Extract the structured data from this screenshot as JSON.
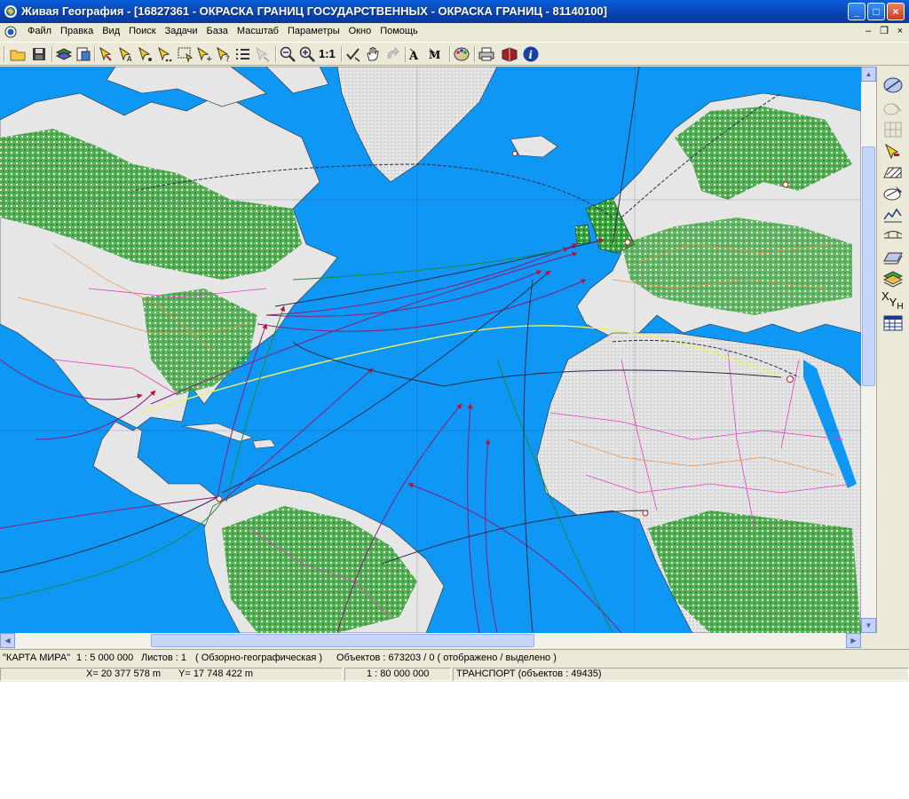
{
  "window": {
    "title": "Живая География - [16827361 - ОКРАСКА ГРАНИЦ ГОСУДАРСТВЕННЫХ - ОКРАСКА ГРАНИЦ - 81140100]",
    "controls": {
      "minimize": "_",
      "maximize": "□",
      "close": "×"
    }
  },
  "menu": {
    "items": [
      "Файл",
      "Правка",
      "Вид",
      "Поиск",
      "Задачи",
      "База",
      "Масштаб",
      "Параметры",
      "Окно",
      "Помощь"
    ],
    "mdi_controls": {
      "minimize": "–",
      "restore": "❐",
      "close": "×"
    }
  },
  "toolbar": {
    "scale_one_to_one": "1:1",
    "icons": [
      "open-folder-icon",
      "save-icon",
      "layers-icon",
      "layer-list-icon",
      "select-point-icon",
      "select-text-icon",
      "select-group-icon",
      "select-multi-icon",
      "select-rect-icon",
      "select-add-icon",
      "select-query-icon",
      "object-list-icon",
      "clear-selection-icon",
      "zoom-out-icon",
      "zoom-in-icon",
      "check-icon",
      "hand-pan-icon",
      "redo-icon",
      "text-label-icon",
      "text-edit-icon",
      "palette-icon",
      "printer-icon",
      "book-icon",
      "info-icon"
    ]
  },
  "right_toolbar": {
    "icons": [
      "measure-icon",
      "cut-tool-icon",
      "grid-disabled-icon",
      "pencil-icon",
      "hatch-area-icon",
      "area-edit-icon",
      "profile-icon",
      "bridge-icon",
      "sheet-icon",
      "layers-stack-icon",
      "xyh-icon",
      "table-icon"
    ],
    "xyh_label": "X",
    "xyh_sub": "Y",
    "xyh_h": "H"
  },
  "status": {
    "map_name": "\"КАРТА МИРА\"",
    "scale": "1 : 5 000 000",
    "sheets": "Листов : 1",
    "map_type": "( Обзорно-географическая )",
    "objects": "Объектов : 673203 / 0 ( отображено / выделено )",
    "x_coord": "X=  20 377 578 m",
    "y_coord": "Y=  17 748 422 m",
    "view_scale": "1 : 80 000 000",
    "layer_info": "ТРАНСПОРТ   (объектов : 49435)"
  },
  "colors": {
    "ocean": "#0f97f5",
    "land": "#e6e6e6",
    "forest": "#2fa82f",
    "route_purple": "#8a1a7a",
    "route_dark": "#2a2a4a",
    "route_green": "#1a8a3a",
    "arrow_red": "#c0103a"
  }
}
